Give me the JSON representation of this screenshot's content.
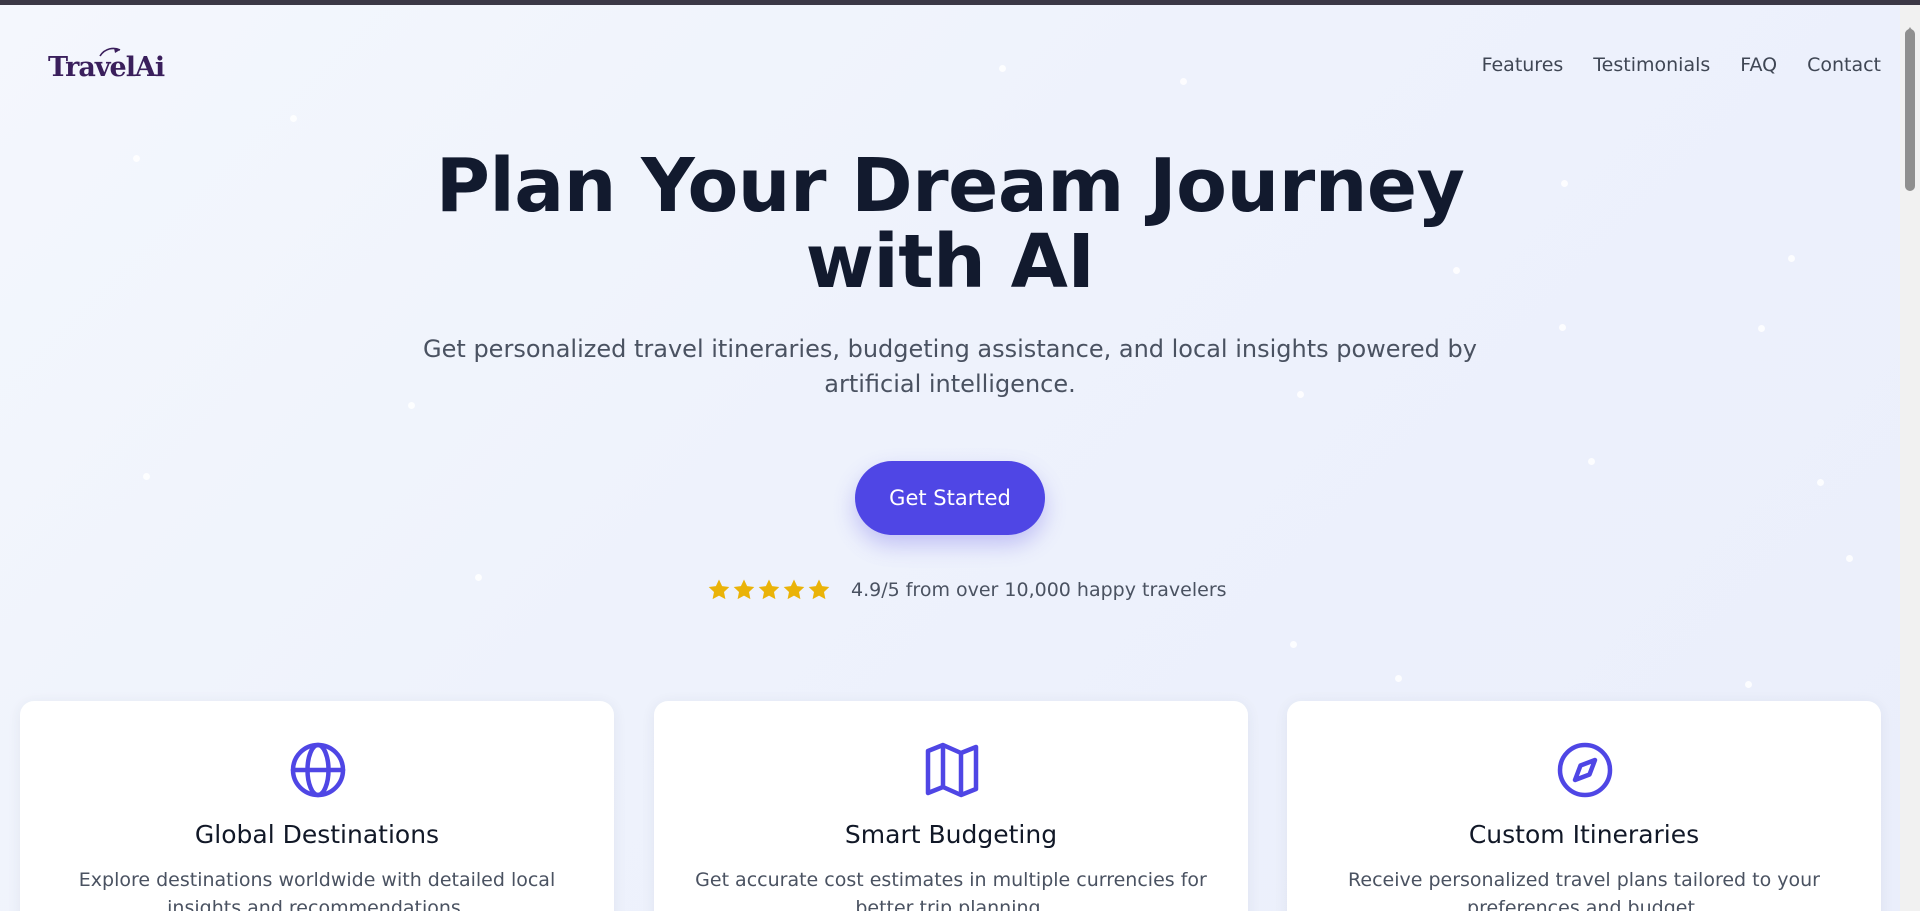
{
  "brand": {
    "logo_text": "TravelAi"
  },
  "nav": {
    "items": [
      {
        "label": "Features"
      },
      {
        "label": "Testimonials"
      },
      {
        "label": "FAQ"
      },
      {
        "label": "Contact"
      }
    ]
  },
  "hero": {
    "title": "Plan Your Dream Journey with AI",
    "subtitle": "Get personalized travel itineraries, budgeting assistance, and local insights powered by artificial intelligence.",
    "cta_label": "Get Started",
    "rating": {
      "stars": 5,
      "text": "4.9/5 from over 10,000 happy travelers"
    }
  },
  "features": [
    {
      "icon": "globe-icon",
      "title": "Global Destinations",
      "description": "Explore destinations worldwide with detailed local insights and recommendations."
    },
    {
      "icon": "map-icon",
      "title": "Smart Budgeting",
      "description": "Get accurate cost estimates in multiple currencies for better trip planning."
    },
    {
      "icon": "compass-icon",
      "title": "Custom Itineraries",
      "description": "Receive personalized travel plans tailored to your preferences and budget."
    }
  ],
  "colors": {
    "accent": "#4f46e5",
    "star": "#eab308",
    "heading": "#121a2e",
    "body_text": "#4a5261",
    "logo": "#3a1f5c"
  }
}
